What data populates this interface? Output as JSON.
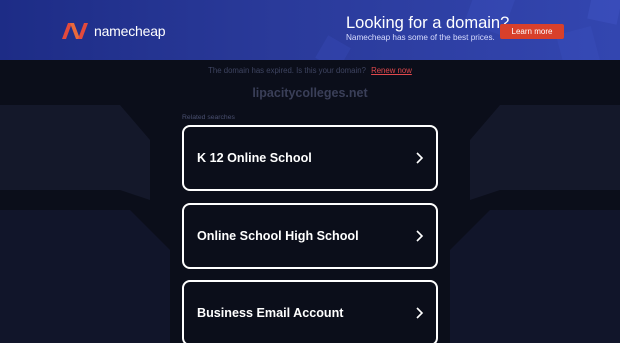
{
  "banner": {
    "brand": "namecheap",
    "promo_title": "Looking for a domain?",
    "promo_subtitle": "Namecheap has some of the best prices.",
    "cta_label": "Learn more",
    "colors": {
      "accent": "#d8402b",
      "banner_bg": "#2a3a9a",
      "logo_red": "#e34a3c"
    }
  },
  "notice": {
    "text": "The domain has expired. Is this your domain?",
    "link_label": "Renew now"
  },
  "domain": "lipacitycolleges.net",
  "related": {
    "heading": "Related searches",
    "items": [
      {
        "label": "K 12 Online School",
        "icon": "chevron-right-icon"
      },
      {
        "label": "Online School High School",
        "icon": "chevron-right-icon"
      },
      {
        "label": "Business Email Account",
        "icon": "chevron-right-icon"
      }
    ]
  }
}
